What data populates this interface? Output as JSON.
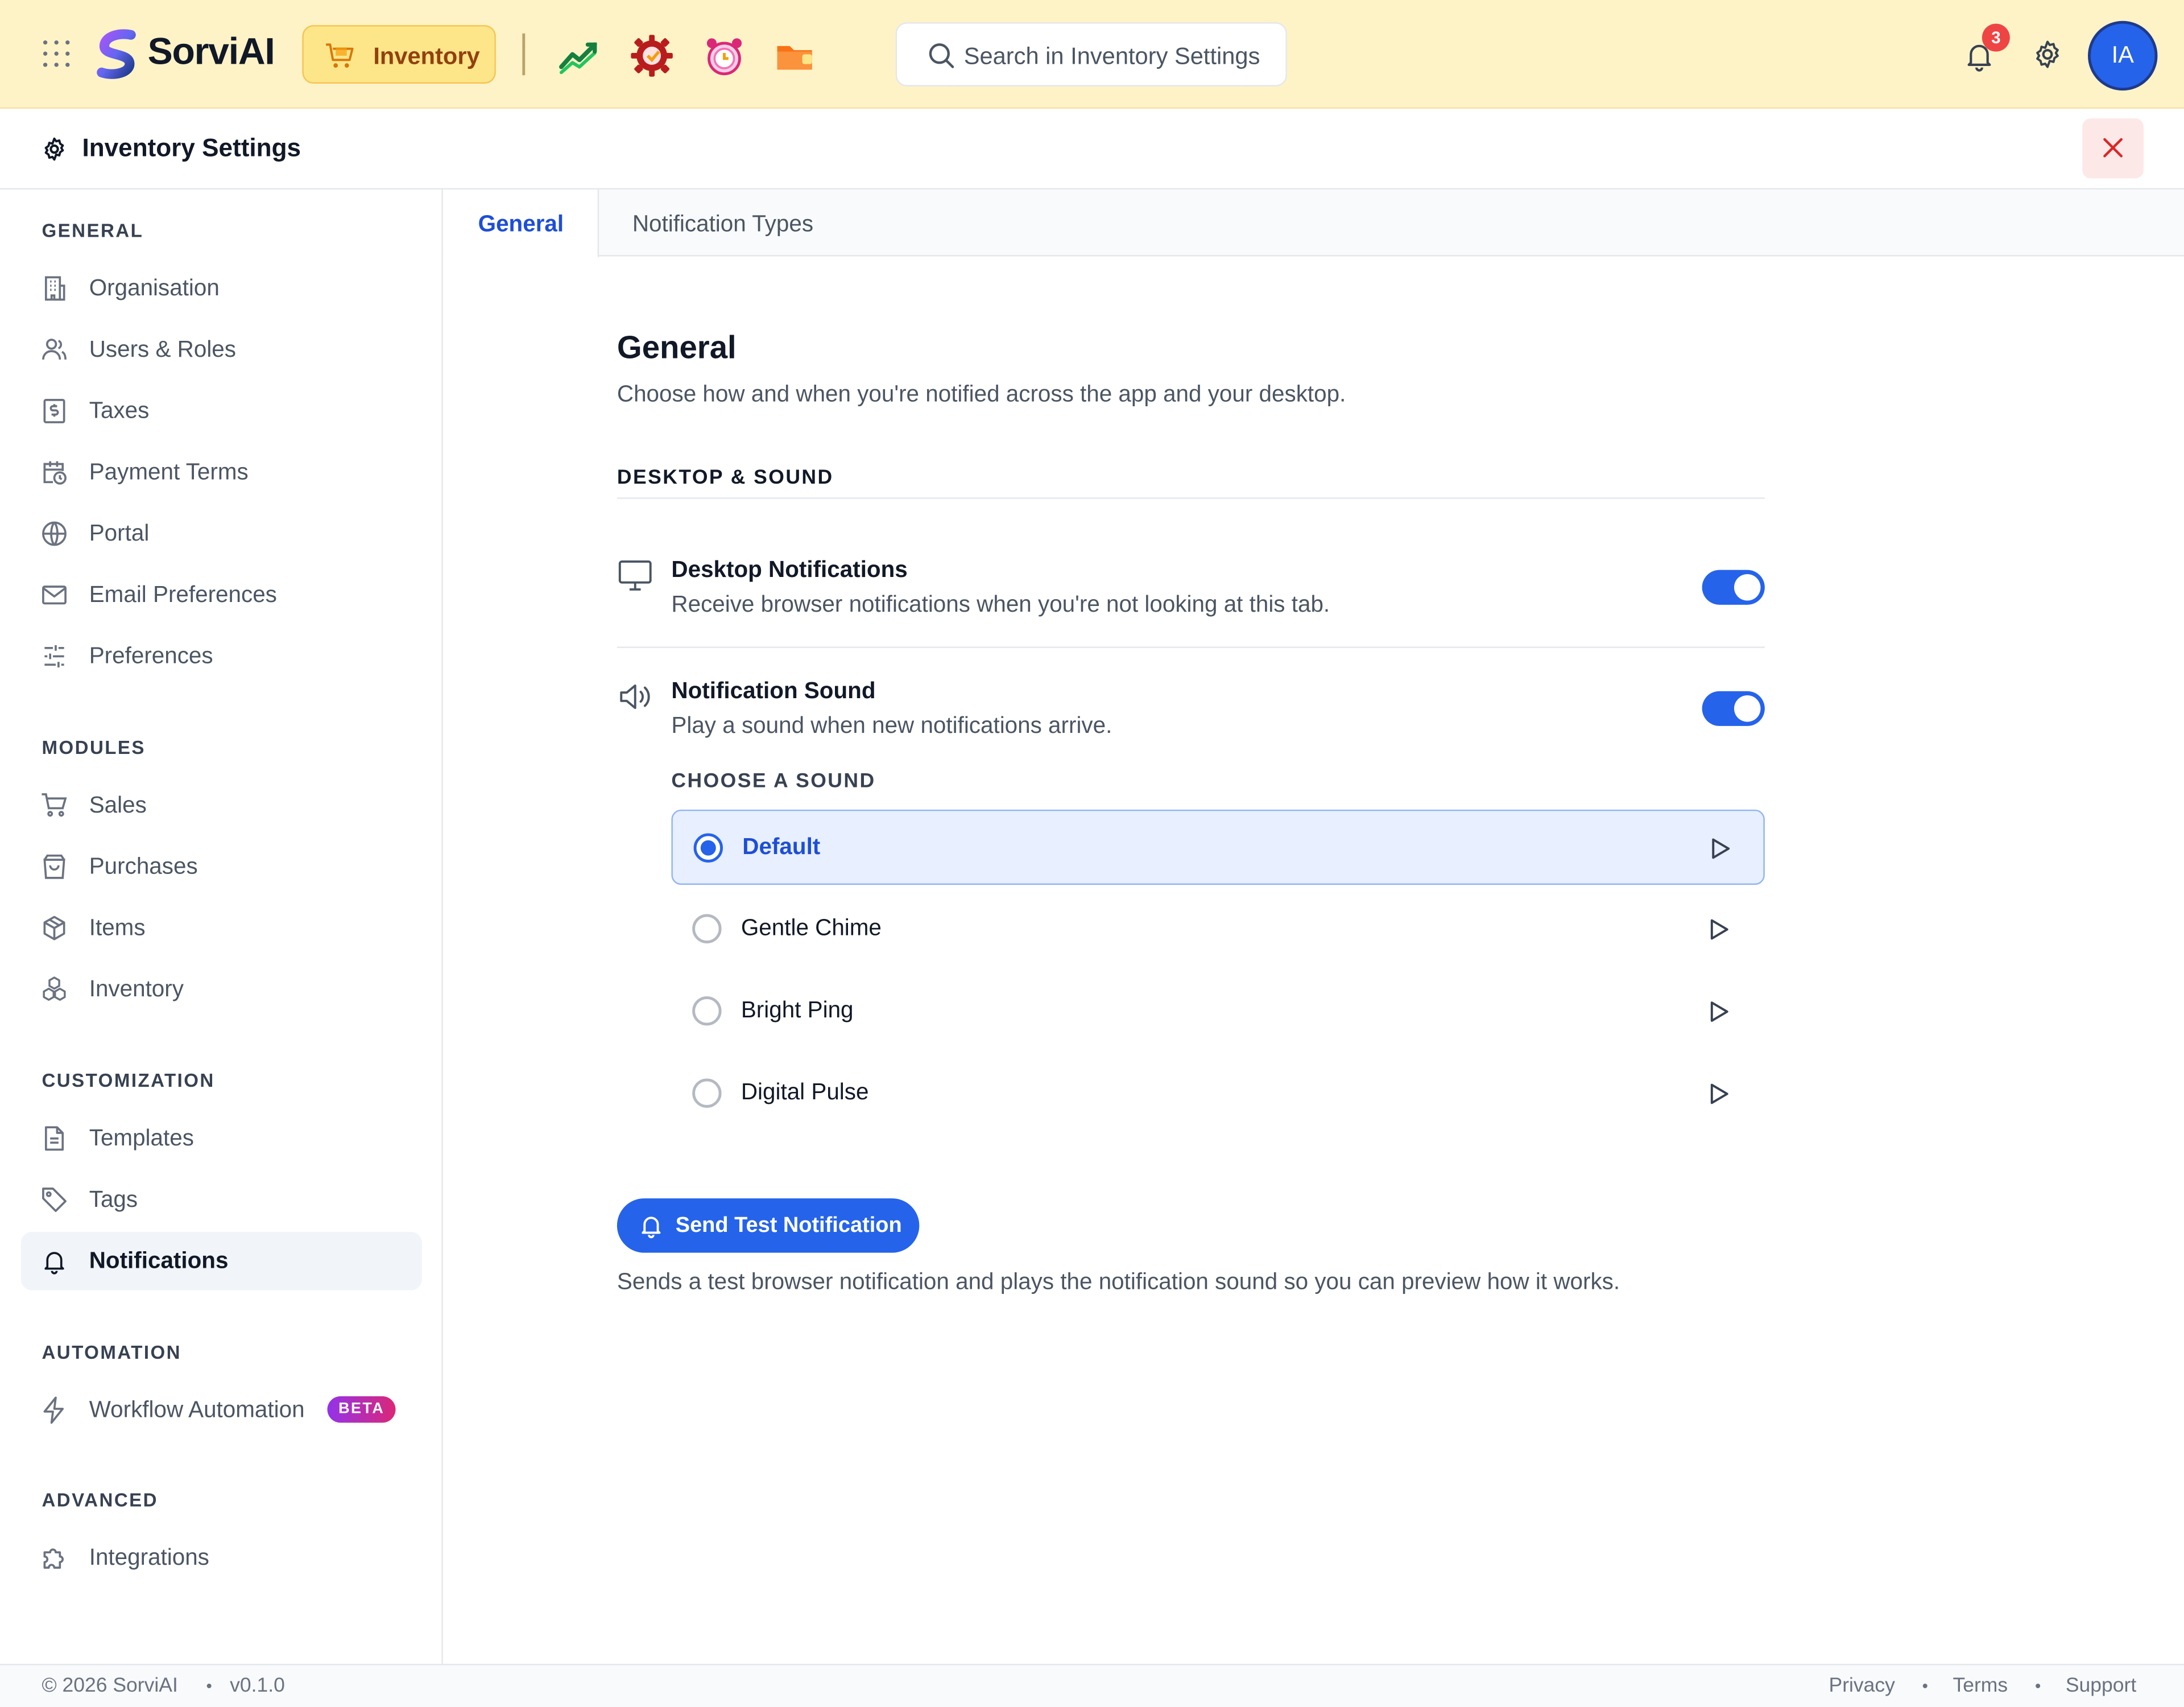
{
  "topbar": {
    "brand": "SorviAI",
    "current_app": "Inventory",
    "search_placeholder": "Search in Inventory Settings",
    "notification_count": "3",
    "avatar_initials": "IA",
    "quick_apps": [
      "growth-chart-icon",
      "settings-gear-app-icon",
      "alarm-clock-icon",
      "folder-app-icon"
    ]
  },
  "subheader": {
    "title": "Inventory Settings"
  },
  "sidebar": {
    "sections": [
      {
        "title": "GENERAL",
        "items": [
          {
            "label": "Organisation",
            "icon": "building-icon"
          },
          {
            "label": "Users & Roles",
            "icon": "users-icon"
          },
          {
            "label": "Taxes",
            "icon": "receipt-dollar-icon"
          },
          {
            "label": "Payment Terms",
            "icon": "calendar-clock-icon"
          },
          {
            "label": "Portal",
            "icon": "globe-icon"
          },
          {
            "label": "Email Preferences",
            "icon": "mail-icon"
          },
          {
            "label": "Preferences",
            "icon": "sliders-icon"
          }
        ]
      },
      {
        "title": "MODULES",
        "items": [
          {
            "label": "Sales",
            "icon": "cart-icon"
          },
          {
            "label": "Purchases",
            "icon": "shopping-bag-icon"
          },
          {
            "label": "Items",
            "icon": "box-icon"
          },
          {
            "label": "Inventory",
            "icon": "boxes-icon"
          }
        ]
      },
      {
        "title": "CUSTOMIZATION",
        "items": [
          {
            "label": "Templates",
            "icon": "document-icon"
          },
          {
            "label": "Tags",
            "icon": "tag-icon"
          },
          {
            "label": "Notifications",
            "icon": "bell-icon",
            "active": true
          }
        ]
      },
      {
        "title": "AUTOMATION",
        "items": [
          {
            "label": "Workflow Automation",
            "icon": "lightning-icon",
            "badge": "BETA"
          }
        ]
      },
      {
        "title": "ADVANCED",
        "items": [
          {
            "label": "Integrations",
            "icon": "puzzle-icon"
          }
        ]
      }
    ]
  },
  "tabs": [
    {
      "label": "General",
      "active": true
    },
    {
      "label": "Notification Types",
      "active": false
    }
  ],
  "main": {
    "title": "General",
    "description": "Choose how and when you're notified across the app and your desktop.",
    "section_title": "DESKTOP & SOUND",
    "desktop": {
      "title": "Desktop Notifications",
      "subtitle": "Receive browser notifications when you're not looking at this tab.",
      "enabled": true
    },
    "sound": {
      "title": "Notification Sound",
      "subtitle": "Play a sound when new notifications arrive.",
      "enabled": true,
      "choose_label": "CHOOSE A SOUND",
      "options": [
        {
          "label": "Default",
          "selected": true
        },
        {
          "label": "Gentle Chime",
          "selected": false
        },
        {
          "label": "Bright Ping",
          "selected": false
        },
        {
          "label": "Digital Pulse",
          "selected": false
        }
      ]
    },
    "test_button": "Send Test Notification",
    "test_description": "Sends a test browser notification and plays the notification sound so you can preview how it works."
  },
  "footer": {
    "copyright": "© 2026 SorviAI",
    "version": "v0.1.0",
    "links": [
      "Privacy",
      "Terms",
      "Support"
    ]
  },
  "colors": {
    "accent": "#2563eb",
    "topbar_bg": "#fef3c7",
    "app_chip_bg": "#fde68a",
    "badge_red": "#ef4444",
    "beta_gradient_start": "#9333ea",
    "beta_gradient_end": "#db2777"
  }
}
